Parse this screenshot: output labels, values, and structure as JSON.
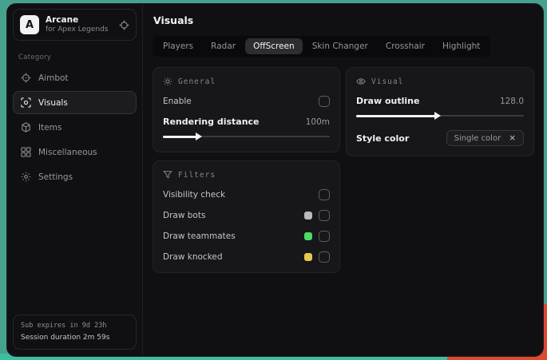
{
  "background": {
    "teal": "#47a18f",
    "red_accent": "#dd4a2d"
  },
  "app": {
    "name": "Arcane",
    "subtitle": "for Apex Legends",
    "logo_letter": "A"
  },
  "sidebar": {
    "category_label": "Category",
    "items": [
      {
        "label": "Aimbot",
        "icon": "crosshair-icon",
        "active": false
      },
      {
        "label": "Visuals",
        "icon": "scan-eye-icon",
        "active": true
      },
      {
        "label": "Items",
        "icon": "package-icon",
        "active": false
      },
      {
        "label": "Miscellaneous",
        "icon": "grid-icon",
        "active": false
      },
      {
        "label": "Settings",
        "icon": "gear-icon",
        "active": false
      }
    ],
    "session": {
      "sub_expires": "Sub expires in 9d 23h",
      "session_duration": "Session duration 2m 59s"
    }
  },
  "header": {
    "title": "Visuals"
  },
  "tabs": {
    "items": [
      "Players",
      "Radar",
      "OffScreen",
      "Skin Changer",
      "Crosshair",
      "Highlight"
    ],
    "active": "OffScreen"
  },
  "panels": {
    "general": {
      "title": "General",
      "enable": {
        "label": "Enable",
        "checked": false
      },
      "rendering_distance": {
        "label": "Rendering distance",
        "value": "100m",
        "percent": 20
      }
    },
    "visual": {
      "title": "Visual",
      "draw_outline": {
        "label": "Draw outline",
        "value": "128.0",
        "percent": 47
      },
      "style_color": {
        "label": "Style color",
        "selected": "Single color",
        "clear_glyph": "×"
      }
    },
    "filters": {
      "title": "Filters",
      "rows": [
        {
          "label": "Visibility check",
          "swatch": null,
          "checked": false
        },
        {
          "label": "Draw bots",
          "swatch": "#b9b9bd",
          "checked": false
        },
        {
          "label": "Draw teammates",
          "swatch": "#4cd964",
          "checked": false
        },
        {
          "label": "Draw knocked",
          "swatch": "#e6c84e",
          "checked": false
        }
      ]
    }
  }
}
